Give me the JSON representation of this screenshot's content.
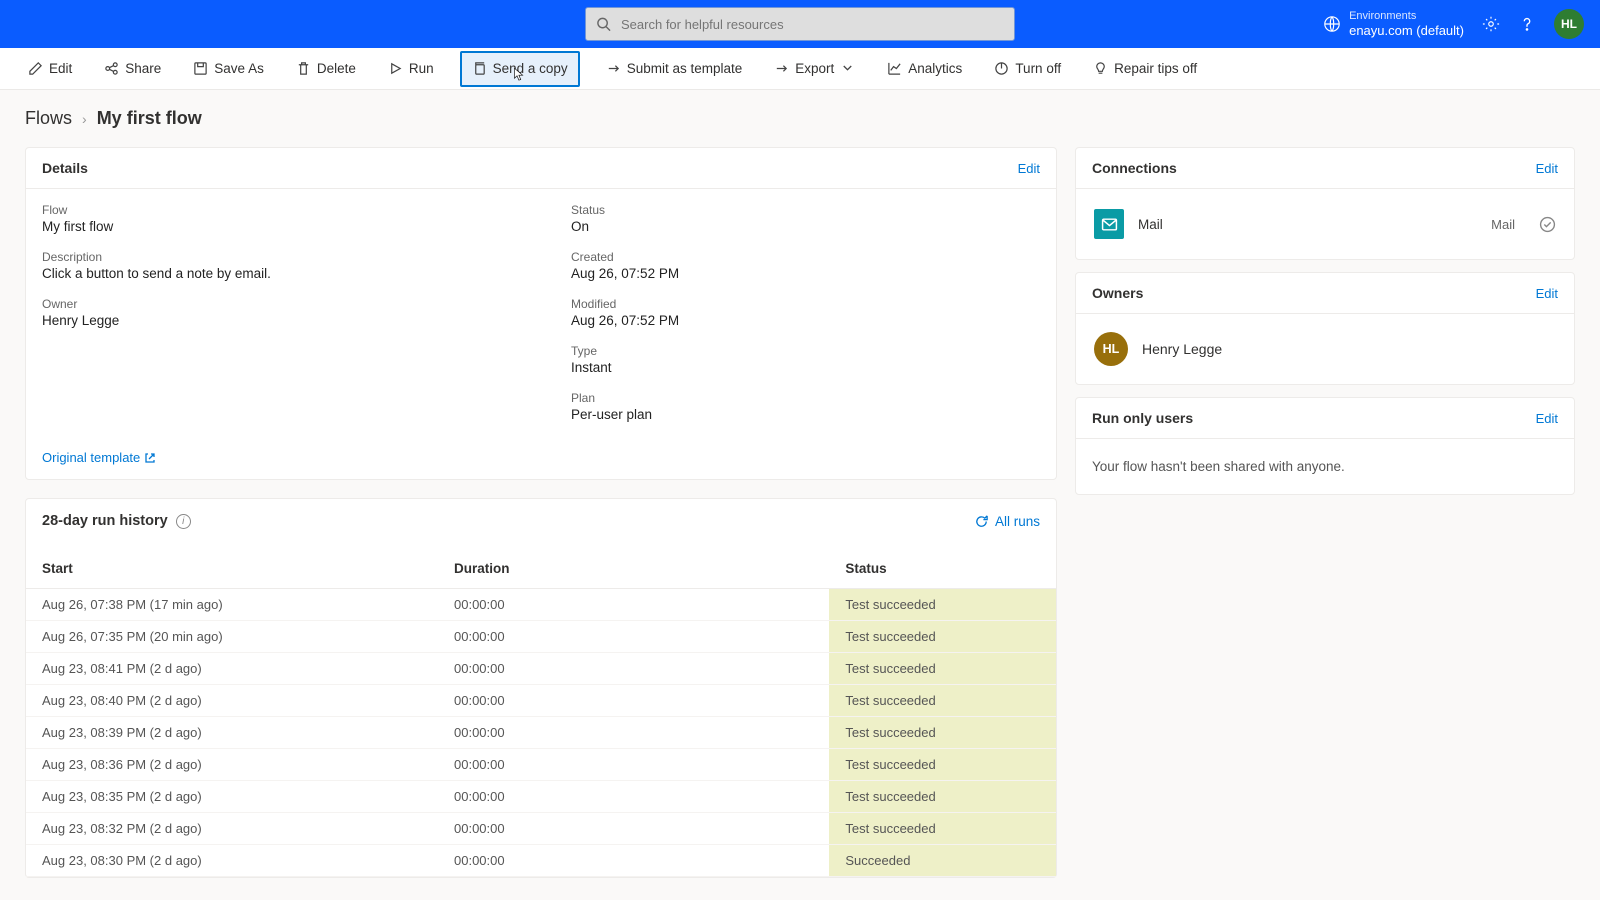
{
  "search": {
    "placeholder": "Search for helpful resources"
  },
  "environment": {
    "label": "Environments",
    "name": "enayu.com (default)"
  },
  "user": {
    "initials": "HL"
  },
  "commands": {
    "edit": "Edit",
    "share": "Share",
    "saveas": "Save As",
    "delete": "Delete",
    "run": "Run",
    "sendcopy": "Send a copy",
    "submit": "Submit as template",
    "export": "Export",
    "analytics": "Analytics",
    "turnoff": "Turn off",
    "repair": "Repair tips off"
  },
  "breadcrumb": {
    "parent": "Flows",
    "current": "My first flow"
  },
  "details": {
    "title": "Details",
    "edit": "Edit",
    "flow_label": "Flow",
    "flow_value": "My first flow",
    "desc_label": "Description",
    "desc_value": "Click a button to send a note by email.",
    "owner_label": "Owner",
    "owner_value": "Henry Legge",
    "status_label": "Status",
    "status_value": "On",
    "created_label": "Created",
    "created_value": "Aug 26, 07:52 PM",
    "modified_label": "Modified",
    "modified_value": "Aug 26, 07:52 PM",
    "type_label": "Type",
    "type_value": "Instant",
    "plan_label": "Plan",
    "plan_value": "Per-user plan",
    "original_link": "Original template"
  },
  "history": {
    "title": "28-day run history",
    "all_runs": "All runs",
    "col_start": "Start",
    "col_duration": "Duration",
    "col_status": "Status",
    "rows": [
      {
        "start": "Aug 26, 07:38 PM (17 min ago)",
        "duration": "00:00:00",
        "status": "Test succeeded"
      },
      {
        "start": "Aug 26, 07:35 PM (20 min ago)",
        "duration": "00:00:00",
        "status": "Test succeeded"
      },
      {
        "start": "Aug 23, 08:41 PM (2 d ago)",
        "duration": "00:00:00",
        "status": "Test succeeded"
      },
      {
        "start": "Aug 23, 08:40 PM (2 d ago)",
        "duration": "00:00:00",
        "status": "Test succeeded"
      },
      {
        "start": "Aug 23, 08:39 PM (2 d ago)",
        "duration": "00:00:00",
        "status": "Test succeeded"
      },
      {
        "start": "Aug 23, 08:36 PM (2 d ago)",
        "duration": "00:00:00",
        "status": "Test succeeded"
      },
      {
        "start": "Aug 23, 08:35 PM (2 d ago)",
        "duration": "00:00:00",
        "status": "Test succeeded"
      },
      {
        "start": "Aug 23, 08:32 PM (2 d ago)",
        "duration": "00:00:00",
        "status": "Test succeeded"
      },
      {
        "start": "Aug 23, 08:30 PM (2 d ago)",
        "duration": "00:00:00",
        "status": "Succeeded"
      }
    ]
  },
  "connections": {
    "title": "Connections",
    "edit": "Edit",
    "items": [
      {
        "name": "Mail",
        "type": "Mail"
      }
    ]
  },
  "owners": {
    "title": "Owners",
    "edit": "Edit",
    "items": [
      {
        "initials": "HL",
        "name": "Henry Legge"
      }
    ]
  },
  "runonly": {
    "title": "Run only users",
    "edit": "Edit",
    "text": "Your flow hasn't been shared with anyone."
  }
}
